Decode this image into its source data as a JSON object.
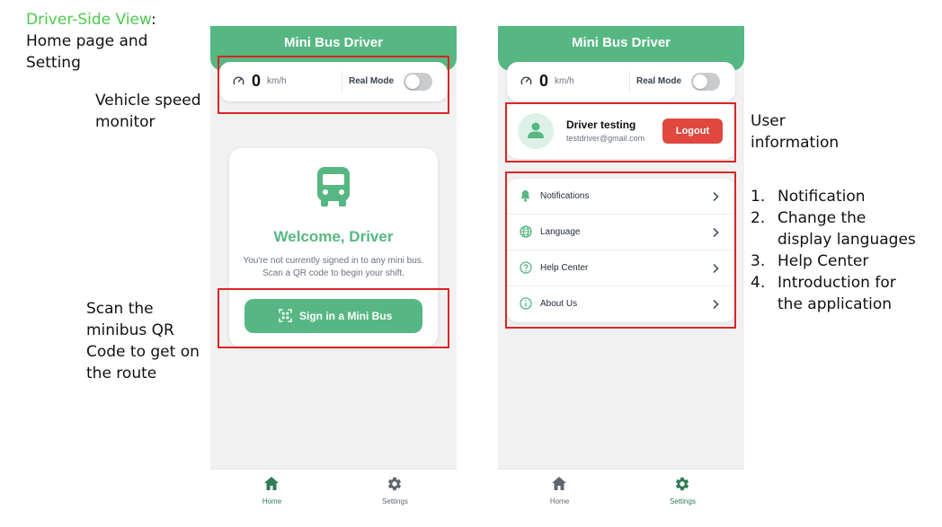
{
  "left_annotations": {
    "title_green": "Driver-Side View",
    "title_colon": ":",
    "title_line2": "Home page and",
    "title_line3": "Setting",
    "speed_line1": "Vehicle speed",
    "speed_line2": "monitor",
    "scan_line1": "Scan the",
    "scan_line2": "minibus QR",
    "scan_line3": "Code to get on",
    "scan_line4": "the route"
  },
  "right_annotations": {
    "user_line1": "User",
    "user_line2": "information",
    "list": [
      {
        "num": "1.",
        "line1": "Notification",
        "line2": ""
      },
      {
        "num": "2.",
        "line1": "Change the",
        "line2": "display languages"
      },
      {
        "num": "3.",
        "line1": "Help Center",
        "line2": ""
      },
      {
        "num": "4.",
        "line1": "Introduction for",
        "line2": "the application"
      }
    ]
  },
  "home_screen": {
    "header_title": "Mini Bus Driver",
    "speed": {
      "value": "0",
      "unit": "km/h",
      "mode_label": "Real Mode",
      "mode_on": false
    },
    "welcome": {
      "title": "Welcome, Driver",
      "message": "You're not currently signed in to any mini bus. Scan a QR code to begin your shift.",
      "button_label": "Sign in a Mini Bus"
    },
    "tabs": [
      {
        "label": "Home",
        "icon": "home-icon",
        "active": true
      },
      {
        "label": "Settings",
        "icon": "gear-icon",
        "active": false
      }
    ]
  },
  "settings_screen": {
    "header_title": "Mini Bus Driver",
    "speed": {
      "value": "0",
      "unit": "km/h",
      "mode_label": "Real Mode",
      "mode_on": false
    },
    "user": {
      "name": "Driver testing",
      "email": "testdriver@gmail.com",
      "logout_label": "Logout"
    },
    "menu": [
      {
        "label": "Notifications",
        "icon": "bell-icon"
      },
      {
        "label": "Language",
        "icon": "globe-icon"
      },
      {
        "label": "Help Center",
        "icon": "help-circle-icon"
      },
      {
        "label": "About Us",
        "icon": "info-icon"
      }
    ],
    "tabs": [
      {
        "label": "Home",
        "icon": "home-icon",
        "active": false
      },
      {
        "label": "Settings",
        "icon": "gear-icon",
        "active": true
      }
    ]
  },
  "colors": {
    "brand_green": "#56b782",
    "annotation_green": "#4cc94c",
    "highlight_red": "#d92525",
    "logout_red": "#e0483f",
    "active_tab": "#2f7d55",
    "inactive_tab": "#5f6670"
  }
}
